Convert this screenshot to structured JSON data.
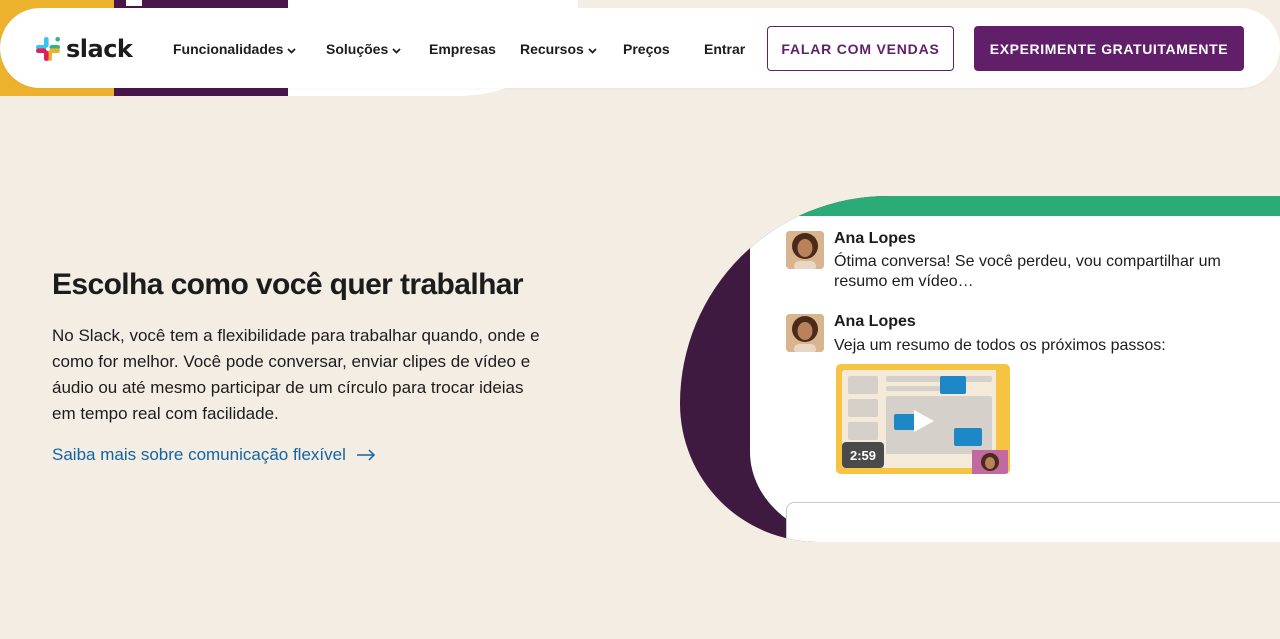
{
  "brand": {
    "logo_text": "slack",
    "colors": {
      "aubergine": "#611f69",
      "yellow": "#ecb22e",
      "green": "#2bac76",
      "blue": "#1264a3",
      "red": "#e01e5a",
      "cyan": "#36c5f0"
    }
  },
  "nav": {
    "items": [
      {
        "label": "Funcionalidades",
        "has_dropdown": true,
        "icon": "chevron-down-icon"
      },
      {
        "label": "Soluções",
        "has_dropdown": true,
        "icon": "chevron-down-icon"
      },
      {
        "label": "Empresas",
        "has_dropdown": false
      },
      {
        "label": "Recursos",
        "has_dropdown": true,
        "icon": "chevron-down-icon"
      },
      {
        "label": "Preços",
        "has_dropdown": false
      },
      {
        "label": "Entrar",
        "has_dropdown": false
      }
    ],
    "cta_secondary": "FALAR COM VENDAS",
    "cta_primary": "EXPERIMENTE GRATUITAMENTE"
  },
  "hero": {
    "heading": "Escolha como você quer trabalhar",
    "body": "No Slack, você tem a flexibilidade para trabalhar quando, onde e como for melhor. Você pode conversar, enviar clipes de vídeo e áudio ou até mesmo participar de um círculo para trocar ideias em tempo real com facilidade.",
    "link_text": "Saiba mais sobre comunicação flexível",
    "link_icon": "arrow-right-icon"
  },
  "illustration": {
    "messages": [
      {
        "author": "Ana Lopes",
        "text": "Ótima conversa! Se você perdeu, vou compartilhar um resumo em vídeo…"
      },
      {
        "author": "Ana Lopes",
        "text": "Veja um resumo de todos os próximos passos:"
      }
    ],
    "video": {
      "duration": "2:59",
      "icon": "play-icon"
    }
  }
}
